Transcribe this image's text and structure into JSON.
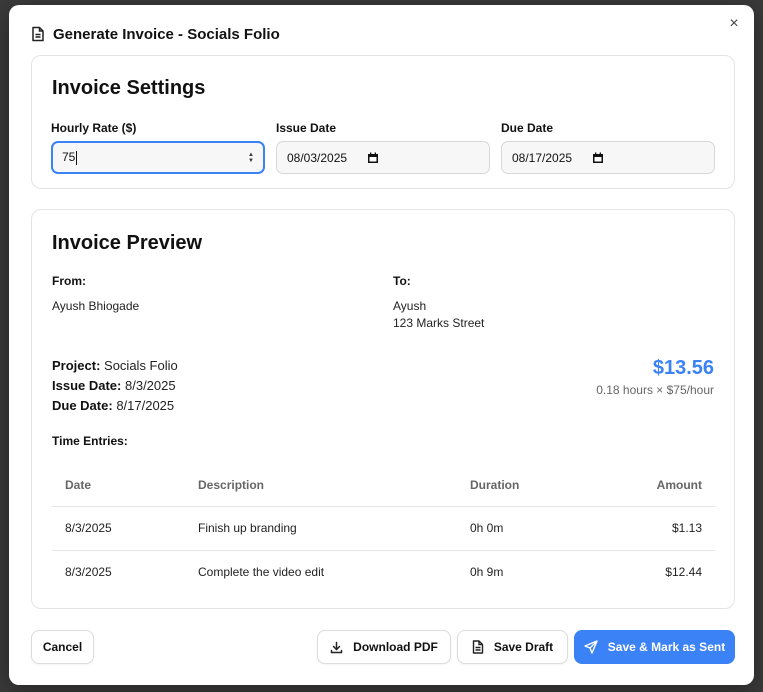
{
  "dialog": {
    "title": "Generate Invoice - Socials Folio",
    "close_label": "×"
  },
  "settings": {
    "title": "Invoice Settings",
    "hourly_rate": {
      "label": "Hourly Rate ($)",
      "value": "75"
    },
    "issue_date": {
      "label": "Issue Date",
      "value": "08/03/2025"
    },
    "due_date": {
      "label": "Due Date",
      "value": "08/17/2025"
    }
  },
  "preview": {
    "title": "Invoice Preview",
    "from_label": "From:",
    "from_name": "Ayush Bhiogade",
    "to_label": "To:",
    "to_name": "Ayush",
    "to_address": "123 Marks Street",
    "project_label": "Project:",
    "project_value": "Socials Folio",
    "issue_label": "Issue Date:",
    "issue_value": "8/3/2025",
    "due_label": "Due Date:",
    "due_value": "8/17/2025",
    "total_amount": "$13.56",
    "total_breakdown": "0.18 hours × $75/hour",
    "entries_label": "Time Entries:",
    "columns": [
      "Date",
      "Description",
      "Duration",
      "Amount"
    ],
    "rows": [
      {
        "date": "8/3/2025",
        "description": "Finish up branding",
        "duration": "0h 0m",
        "amount": "$1.13"
      },
      {
        "date": "8/3/2025",
        "description": "Complete the video edit",
        "duration": "0h 9m",
        "amount": "$12.44"
      }
    ]
  },
  "footer": {
    "cancel_label": "Cancel",
    "download_label": "Download PDF",
    "save_draft_label": "Save Draft",
    "save_sent_label": "Save & Mark as Sent"
  },
  "colors": {
    "accent": "#3b82f6"
  },
  "icons": {
    "title": "document-icon",
    "download": "download-icon",
    "draft": "document-icon",
    "send": "send-icon",
    "close": "close-icon",
    "calendar": "calendar-icon"
  }
}
